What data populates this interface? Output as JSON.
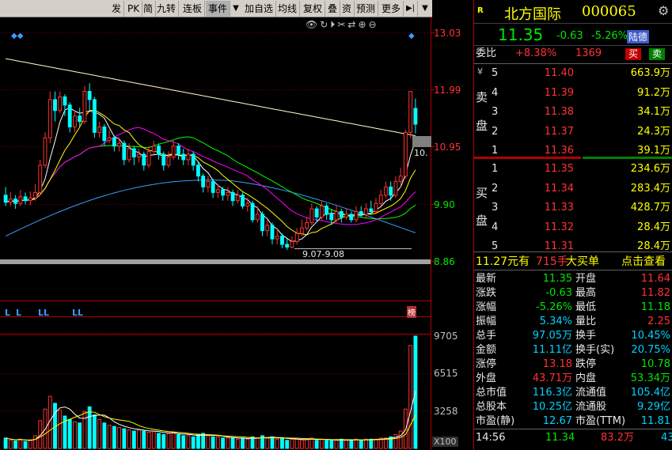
{
  "toolbar": {
    "items": [
      "发",
      "PK",
      "简",
      "九转",
      "连板",
      "事件"
    ],
    "items2": [
      "加自选",
      "均线",
      "复权",
      "叠",
      "资",
      "预测",
      "更多"
    ]
  },
  "chart": {
    "price_ticks": [
      "13.03",
      "11.99",
      "10.95",
      "9.90",
      "8.86"
    ],
    "current_price_label": "10.",
    "range_label": "9.07-9.08",
    "volume_ticks": [
      "9705",
      "6515",
      "3258",
      "X100"
    ],
    "bang_label": "榜",
    "l_markers": [
      "L",
      "L",
      "LL",
      "LL"
    ],
    "colors": {
      "up": "#ff3232",
      "down": "#00ffff",
      "ma5": "#ffffff",
      "ma10": "#ffff00",
      "ma20": "#ff00ff",
      "ma60": "#00ff00",
      "ma120": "#3c9cff",
      "ma250": "#ffffc8"
    }
  },
  "chart_data": {
    "type": "candlestick",
    "price_axis_ticks": [
      13.03,
      11.99,
      10.95,
      9.9,
      8.86
    ],
    "volume_axis_ticks": [
      9705,
      6515,
      3258
    ],
    "volume_unit": "X100",
    "range_annotation": "9.07-9.08",
    "candles": [
      {
        "o": 10.05,
        "c": 9.92,
        "h": 10.2,
        "l": 9.85
      },
      {
        "o": 9.92,
        "c": 9.98,
        "h": 10.1,
        "l": 9.85
      },
      {
        "o": 9.98,
        "c": 9.9,
        "h": 10.05,
        "l": 9.8
      },
      {
        "o": 9.9,
        "c": 10.02,
        "h": 10.15,
        "l": 9.85
      },
      {
        "o": 10.02,
        "c": 9.95,
        "h": 10.1,
        "l": 9.88
      },
      {
        "o": 9.95,
        "c": 10.0,
        "h": 10.12,
        "l": 9.86
      },
      {
        "o": 10.0,
        "c": 10.1,
        "h": 10.25,
        "l": 9.95
      },
      {
        "o": 10.1,
        "c": 10.6,
        "h": 10.7,
        "l": 10.05
      },
      {
        "o": 10.6,
        "c": 11.1,
        "h": 11.2,
        "l": 10.55
      },
      {
        "o": 11.1,
        "c": 11.8,
        "h": 11.95,
        "l": 11.0
      },
      {
        "o": 11.8,
        "c": 11.6,
        "h": 11.95,
        "l": 11.4
      },
      {
        "o": 11.6,
        "c": 11.85,
        "h": 11.95,
        "l": 11.55
      },
      {
        "o": 11.85,
        "c": 11.7,
        "h": 11.9,
        "l": 11.5
      },
      {
        "o": 11.7,
        "c": 11.3,
        "h": 11.75,
        "l": 11.2
      },
      {
        "o": 11.3,
        "c": 11.5,
        "h": 11.6,
        "l": 11.2
      },
      {
        "o": 11.5,
        "c": 11.4,
        "h": 11.65,
        "l": 11.3
      },
      {
        "o": 11.4,
        "c": 11.95,
        "h": 12.05,
        "l": 11.35
      },
      {
        "o": 11.95,
        "c": 11.8,
        "h": 12.1,
        "l": 11.6
      },
      {
        "o": 11.8,
        "c": 11.2,
        "h": 11.85,
        "l": 11.1
      },
      {
        "o": 11.2,
        "c": 11.3,
        "h": 11.4,
        "l": 11.1
      },
      {
        "o": 11.3,
        "c": 11.05,
        "h": 11.35,
        "l": 10.95
      },
      {
        "o": 11.05,
        "c": 11.1,
        "h": 11.25,
        "l": 11.0
      },
      {
        "o": 11.1,
        "c": 10.95,
        "h": 11.15,
        "l": 10.85
      },
      {
        "o": 10.95,
        "c": 11.0,
        "h": 11.1,
        "l": 10.85
      },
      {
        "o": 11.0,
        "c": 10.7,
        "h": 11.05,
        "l": 10.6
      },
      {
        "o": 10.7,
        "c": 10.9,
        "h": 11.0,
        "l": 10.65
      },
      {
        "o": 10.9,
        "c": 10.75,
        "h": 10.95,
        "l": 10.6
      },
      {
        "o": 10.75,
        "c": 10.8,
        "h": 10.9,
        "l": 10.65
      },
      {
        "o": 10.8,
        "c": 10.6,
        "h": 10.85,
        "l": 10.5
      },
      {
        "o": 10.6,
        "c": 10.85,
        "h": 10.95,
        "l": 10.55
      },
      {
        "o": 10.85,
        "c": 10.95,
        "h": 11.05,
        "l": 10.8
      },
      {
        "o": 10.95,
        "c": 10.8,
        "h": 11.0,
        "l": 10.7
      },
      {
        "o": 10.8,
        "c": 10.6,
        "h": 10.85,
        "l": 10.5
      },
      {
        "o": 10.6,
        "c": 10.75,
        "h": 10.85,
        "l": 10.55
      },
      {
        "o": 10.75,
        "c": 10.95,
        "h": 11.05,
        "l": 10.7
      },
      {
        "o": 10.95,
        "c": 10.8,
        "h": 11.0,
        "l": 10.7
      },
      {
        "o": 10.8,
        "c": 10.7,
        "h": 10.9,
        "l": 10.6
      },
      {
        "o": 10.7,
        "c": 10.8,
        "h": 10.9,
        "l": 10.6
      },
      {
        "o": 10.8,
        "c": 10.6,
        "h": 10.85,
        "l": 10.5
      },
      {
        "o": 10.6,
        "c": 10.4,
        "h": 10.65,
        "l": 10.3
      },
      {
        "o": 10.4,
        "c": 10.2,
        "h": 10.45,
        "l": 10.1
      },
      {
        "o": 10.2,
        "c": 10.3,
        "h": 10.4,
        "l": 10.1
      },
      {
        "o": 10.3,
        "c": 10.1,
        "h": 10.35,
        "l": 10.0
      },
      {
        "o": 10.1,
        "c": 10.15,
        "h": 10.25,
        "l": 10.0
      },
      {
        "o": 10.15,
        "c": 10.05,
        "h": 10.2,
        "l": 9.95
      },
      {
        "o": 10.05,
        "c": 10.1,
        "h": 10.2,
        "l": 9.95
      },
      {
        "o": 10.1,
        "c": 9.95,
        "h": 10.15,
        "l": 9.85
      },
      {
        "o": 9.95,
        "c": 10.05,
        "h": 10.15,
        "l": 9.9
      },
      {
        "o": 10.05,
        "c": 9.85,
        "h": 10.1,
        "l": 9.8
      },
      {
        "o": 9.85,
        "c": 9.9,
        "h": 10.0,
        "l": 9.75
      },
      {
        "o": 9.9,
        "c": 9.6,
        "h": 9.95,
        "l": 9.55
      },
      {
        "o": 9.6,
        "c": 9.7,
        "h": 9.85,
        "l": 9.55
      },
      {
        "o": 9.7,
        "c": 9.4,
        "h": 9.75,
        "l": 9.3
      },
      {
        "o": 9.4,
        "c": 9.5,
        "h": 9.6,
        "l": 9.3
      },
      {
        "o": 9.5,
        "c": 9.25,
        "h": 9.55,
        "l": 9.15
      },
      {
        "o": 9.25,
        "c": 9.3,
        "h": 9.45,
        "l": 9.15
      },
      {
        "o": 9.3,
        "c": 9.15,
        "h": 9.35,
        "l": 9.08
      },
      {
        "o": 9.15,
        "c": 9.1,
        "h": 9.25,
        "l": 9.05
      },
      {
        "o": 9.1,
        "c": 9.2,
        "h": 9.3,
        "l": 9.07
      },
      {
        "o": 9.2,
        "c": 9.35,
        "h": 9.45,
        "l": 9.15
      },
      {
        "o": 9.35,
        "c": 9.45,
        "h": 9.6,
        "l": 9.3
      },
      {
        "o": 9.45,
        "c": 9.55,
        "h": 9.65,
        "l": 9.4
      },
      {
        "o": 9.55,
        "c": 9.8,
        "h": 9.9,
        "l": 9.5
      },
      {
        "o": 9.8,
        "c": 9.65,
        "h": 9.85,
        "l": 9.55
      },
      {
        "o": 9.65,
        "c": 9.85,
        "h": 9.95,
        "l": 9.6
      },
      {
        "o": 9.85,
        "c": 9.7,
        "h": 9.9,
        "l": 9.6
      },
      {
        "o": 9.7,
        "c": 9.6,
        "h": 9.8,
        "l": 9.5
      },
      {
        "o": 9.6,
        "c": 9.75,
        "h": 9.85,
        "l": 9.55
      },
      {
        "o": 9.75,
        "c": 9.65,
        "h": 9.8,
        "l": 9.55
      },
      {
        "o": 9.65,
        "c": 9.7,
        "h": 9.8,
        "l": 9.6
      },
      {
        "o": 9.7,
        "c": 9.6,
        "h": 9.75,
        "l": 9.55
      },
      {
        "o": 9.6,
        "c": 9.75,
        "h": 9.85,
        "l": 9.55
      },
      {
        "o": 9.75,
        "c": 9.7,
        "h": 9.85,
        "l": 9.65
      },
      {
        "o": 9.7,
        "c": 9.8,
        "h": 9.9,
        "l": 9.65
      },
      {
        "o": 9.8,
        "c": 9.75,
        "h": 9.95,
        "l": 9.7
      },
      {
        "o": 9.75,
        "c": 9.9,
        "h": 10.0,
        "l": 9.7
      },
      {
        "o": 9.9,
        "c": 10.05,
        "h": 10.15,
        "l": 9.85
      },
      {
        "o": 10.05,
        "c": 10.2,
        "h": 10.3,
        "l": 10.0
      },
      {
        "o": 10.2,
        "c": 10.05,
        "h": 10.3,
        "l": 9.95
      },
      {
        "o": 10.05,
        "c": 10.3,
        "h": 10.4,
        "l": 10.0
      },
      {
        "o": 10.3,
        "c": 10.4,
        "h": 10.55,
        "l": 10.2
      },
      {
        "o": 10.4,
        "c": 11.2,
        "h": 11.25,
        "l": 10.35
      },
      {
        "o": 11.2,
        "c": 11.95,
        "h": 11.95,
        "l": 11.1
      },
      {
        "o": 11.64,
        "c": 11.35,
        "h": 11.82,
        "l": 11.18
      }
    ],
    "volumes": [
      900,
      700,
      650,
      800,
      600,
      700,
      1100,
      2400,
      3400,
      4500,
      3900,
      3300,
      2800,
      2500,
      2300,
      2200,
      3200,
      3600,
      2900,
      2500,
      2200,
      2000,
      1900,
      1800,
      1700,
      1600,
      1500,
      1600,
      1500,
      1400,
      1500,
      1300,
      1200,
      1300,
      1400,
      1200,
      1100,
      1100,
      1000,
      1200,
      1300,
      1100,
      1000,
      1000,
      900,
      900,
      900,
      800,
      900,
      800,
      1000,
      900,
      1100,
      900,
      1000,
      800,
      900,
      700,
      800,
      800,
      700,
      800,
      900,
      700,
      800,
      700,
      700,
      700,
      800,
      700,
      700,
      800,
      700,
      800,
      800,
      800,
      900,
      900,
      1000,
      1200,
      1500,
      3400,
      8900,
      9705
    ]
  },
  "stock": {
    "badge": "R",
    "name": "北方国际",
    "code": "000065",
    "price": "11.35",
    "change": "-0.63",
    "change_pct": "-5.26%",
    "tag": "陆德",
    "weibi_label": "委比",
    "weibi_value": "+8.38%",
    "weibi_count": "1369",
    "buy_btn": "买",
    "sell_btn": "卖"
  },
  "asks_label": [
    "卖",
    "盘"
  ],
  "bids_label": [
    "买",
    "盘"
  ],
  "asks": [
    {
      "level": "5",
      "price": "11.40",
      "vol": "663.9万"
    },
    {
      "level": "4",
      "price": "11.39",
      "vol": "91.2万"
    },
    {
      "level": "3",
      "price": "11.38",
      "vol": "34.1万"
    },
    {
      "level": "2",
      "price": "11.37",
      "vol": "24.3万"
    },
    {
      "level": "1",
      "price": "11.36",
      "vol": "39.1万"
    }
  ],
  "bids": [
    {
      "level": "1",
      "price": "11.35",
      "vol": "234.6万"
    },
    {
      "level": "2",
      "price": "11.34",
      "vol": "283.4万"
    },
    {
      "level": "3",
      "price": "11.33",
      "vol": "428.7万"
    },
    {
      "level": "4",
      "price": "11.32",
      "vol": "28.4万"
    },
    {
      "level": "5",
      "price": "11.31",
      "vol": "28.4万"
    }
  ],
  "big_order": {
    "amount": "11.27元有",
    "vol": "715手",
    "label": "大买单",
    "link": "点击查看"
  },
  "stats": [
    {
      "l1": "最新",
      "v1": "11.35",
      "c1": "green",
      "l2": "开盘",
      "v2": "11.64",
      "c2": "red"
    },
    {
      "l1": "涨跌",
      "v1": "-0.63",
      "c1": "green",
      "l2": "最高",
      "v2": "11.82",
      "c2": "red"
    },
    {
      "l1": "涨幅",
      "v1": "-5.26%",
      "c1": "green",
      "l2": "最低",
      "v2": "11.18",
      "c2": "green"
    },
    {
      "l1": "振幅",
      "v1": "5.34%",
      "c1": "cyan",
      "l2": "量比",
      "v2": "2.25",
      "c2": "red"
    },
    {
      "l1": "总手",
      "v1": "97.05万",
      "c1": "cyan",
      "l2": "换手",
      "v2": "10.45%",
      "c2": "cyan"
    },
    {
      "l1": "金额",
      "v1": "11.11亿",
      "c1": "cyan",
      "l2": "换手(实)",
      "v2": "20.75%",
      "c2": "cyan"
    },
    {
      "l1": "涨停",
      "v1": "13.18",
      "c1": "red",
      "l2": "跌停",
      "v2": "10.78",
      "c2": "green"
    },
    {
      "l1": "外盘",
      "v1": "43.71万",
      "c1": "red",
      "l2": "内盘",
      "v2": "53.34万",
      "c2": "green"
    },
    {
      "l1": "总市值",
      "v1": "116.3亿",
      "c1": "cyan",
      "l2": "流通值",
      "v2": "105.4亿",
      "c2": "cyan"
    },
    {
      "l1": "总股本",
      "v1": "10.25亿",
      "c1": "cyan",
      "l2": "流通股",
      "v2": "9.29亿",
      "c2": "cyan"
    },
    {
      "l1": "市盈(静)",
      "v1": "12.67",
      "c1": "cyan",
      "l2": "市盈(TTM)",
      "v2": "11.81",
      "c2": "cyan"
    }
  ],
  "tick": {
    "time": "14:56",
    "price": "11.34",
    "vol": "83.2万",
    "extra": "43"
  }
}
